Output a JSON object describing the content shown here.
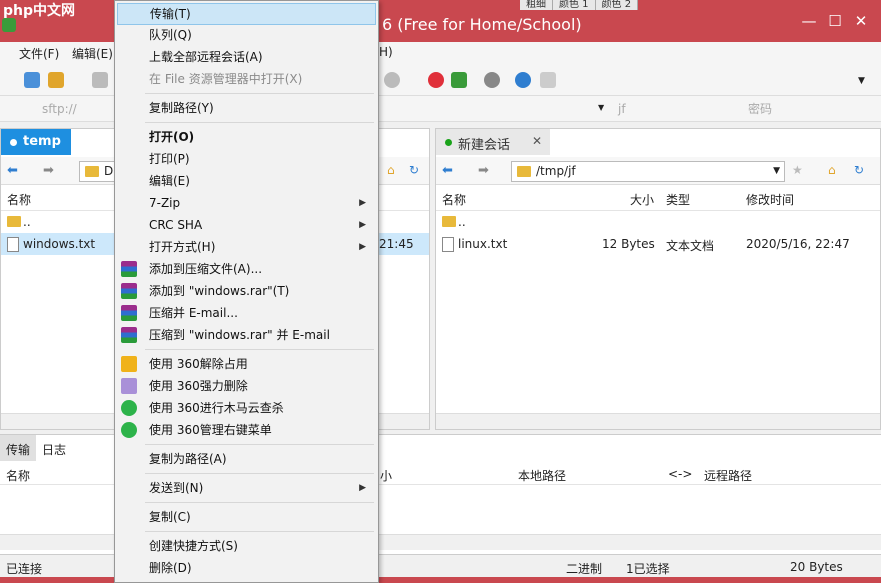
{
  "window": {
    "logo_text": "php中文网",
    "title": "6 (Free for Home/School)",
    "color_tabs": [
      "粗细",
      "颜色 1",
      "颜色 2"
    ],
    "accent_color": "#c9484f"
  },
  "menubar": {
    "items": [
      "文件(F)",
      "编辑(E)",
      "H)"
    ]
  },
  "addrbar": {
    "host": "sftp://",
    "user": "jf",
    "password_placeholder": "密码"
  },
  "left_pane": {
    "tab_label": "temp",
    "path": "D:\\",
    "col_name": "名称",
    "rows": [
      {
        "name": "..",
        "time": ""
      },
      {
        "name": "windows.txt",
        "time": "21:45"
      }
    ]
  },
  "right_pane": {
    "tab_label": "新建会话",
    "path": "/tmp/jf",
    "columns": [
      "名称",
      "大小",
      "类型",
      "修改时间"
    ],
    "rows": [
      {
        "name": "..",
        "size": "",
        "type": "",
        "mtime": ""
      },
      {
        "name": "linux.txt",
        "size": "12 Bytes",
        "type": "文本文档",
        "mtime": "2020/5/16, 22:47"
      }
    ]
  },
  "transfer": {
    "tabs": [
      "传输",
      "日志"
    ],
    "columns": [
      "名称",
      "小",
      "本地路径",
      "<->",
      "远程路径"
    ]
  },
  "status": {
    "left": "已连接",
    "mode": "二进制",
    "selection": "1已选择",
    "size": "20 Bytes"
  },
  "context_menu": {
    "items": [
      {
        "label": "传输(T)",
        "highlight": true
      },
      {
        "label": "队列(Q)"
      },
      {
        "label": "上载全部远程会话(A)"
      },
      {
        "label": "在 File 资源管理器中打开(X)",
        "disabled": true
      },
      {
        "label": "复制路径(Y)"
      },
      {
        "label": "打开(O)",
        "bold": true
      },
      {
        "label": "打印(P)"
      },
      {
        "label": "编辑(E)"
      },
      {
        "label": "7-Zip",
        "submenu": true
      },
      {
        "label": "CRC SHA",
        "submenu": true
      },
      {
        "label": "打开方式(H)",
        "submenu": true
      },
      {
        "label": "添加到压缩文件(A)..."
      },
      {
        "label": "添加到 \"windows.rar\"(T)"
      },
      {
        "label": "压缩并 E-mail..."
      },
      {
        "label": "压缩到 \"windows.rar\" 并 E-mail"
      },
      {
        "label": "使用 360解除占用"
      },
      {
        "label": "使用 360强力删除"
      },
      {
        "label": "使用 360进行木马云查杀"
      },
      {
        "label": "使用 360管理右键菜单"
      },
      {
        "label": "复制为路径(A)"
      },
      {
        "label": "发送到(N)",
        "submenu": true
      },
      {
        "label": "复制(C)"
      },
      {
        "label": "创建快捷方式(S)"
      },
      {
        "label": "删除(D)"
      }
    ]
  }
}
